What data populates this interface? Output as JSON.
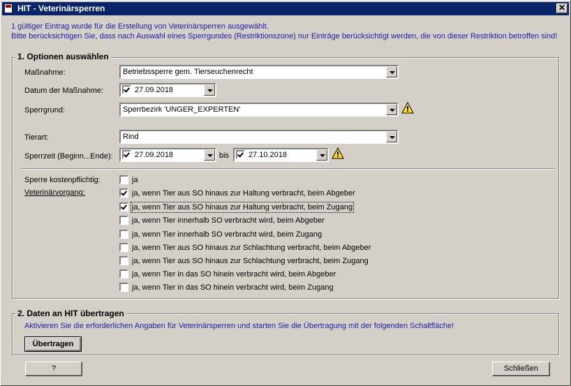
{
  "window": {
    "title": "HIT - Veterinärsperren",
    "close_label": "✕"
  },
  "info": {
    "line1": "1 gültiger Eintrag wurde für die Erstellung von Veterinärsperren ausgewählt.",
    "line2": "Bitte berücksichtigen Sie, dass nach Auswahl eines Sperrgundes (Restriktionszone) nur Einträge berücksichtigt werden, die von dieser Restriktion betroffen sind!"
  },
  "section1": {
    "legend": "1. Optionen auswählen",
    "massnahme": {
      "label": "Maßnahme:",
      "value": "Betriebssperre gem. Tierseuchenrecht"
    },
    "datum": {
      "label": "Datum der Maßnahme:",
      "value": "27.09.2018",
      "checked": true
    },
    "sperrgrund": {
      "label": "Sperrgrund:",
      "value": "Sperrbezirk 'UNGER_EXPERTEN'"
    },
    "tierart": {
      "label": "Tierart:",
      "value": "Rind"
    },
    "sperrzeit": {
      "label": "Sperrzeit (Beginn...Ende):",
      "begin": "27.09.2018",
      "bis": "bis",
      "end": "27.10.2018"
    },
    "kosten": {
      "label": "Sperre kostenpflichtig:",
      "option": "ja",
      "checked": false
    },
    "vorgang": {
      "label": "Veterinärvorgang:",
      "options": [
        {
          "label": "ja, wenn Tier aus SO hinaus zur Haltung verbracht, beim Abgeber",
          "checked": true
        },
        {
          "label": "ja, wenn Tier aus SO hinaus zur Haltung verbracht, beim Zugang",
          "checked": true
        },
        {
          "label": "ja, wenn Tier  innerhalb SO verbracht wird, beim Abgeber",
          "checked": false
        },
        {
          "label": "ja, wenn Tier  innerhalb SO verbracht wird, beim Zugang",
          "checked": false
        },
        {
          "label": "ja, wenn Tier aus SO hinaus zur Schlachtung verbracht, beim Abgeber",
          "checked": false
        },
        {
          "label": "ja, wenn Tier aus SO hinaus zur Schlachtung verbracht, beim Zugang",
          "checked": false
        },
        {
          "label": "ja, wenn Tier in das SO hinein verbracht wird, beim Abgeber",
          "checked": false
        },
        {
          "label": "ja, wenn Tier in das SO hinein verbracht wird, beim Zugang",
          "checked": false
        }
      ]
    }
  },
  "section2": {
    "legend": "2. Daten an HIT übertragen",
    "text": "Aktivieren Sie die erforderlichen Angaben für Veterinärsperren und starten Sie die Übertragung mit der folgenden Schaltfläche!",
    "button": "Übertragen"
  },
  "footer": {
    "help": "?",
    "close": "Schließen"
  },
  "colors": {
    "title_bg": "#0a246a",
    "info_text": "#1c1ca8",
    "face": "#d4d0c8"
  },
  "icons": {
    "warning": "warning-icon",
    "app": "app-icon"
  }
}
